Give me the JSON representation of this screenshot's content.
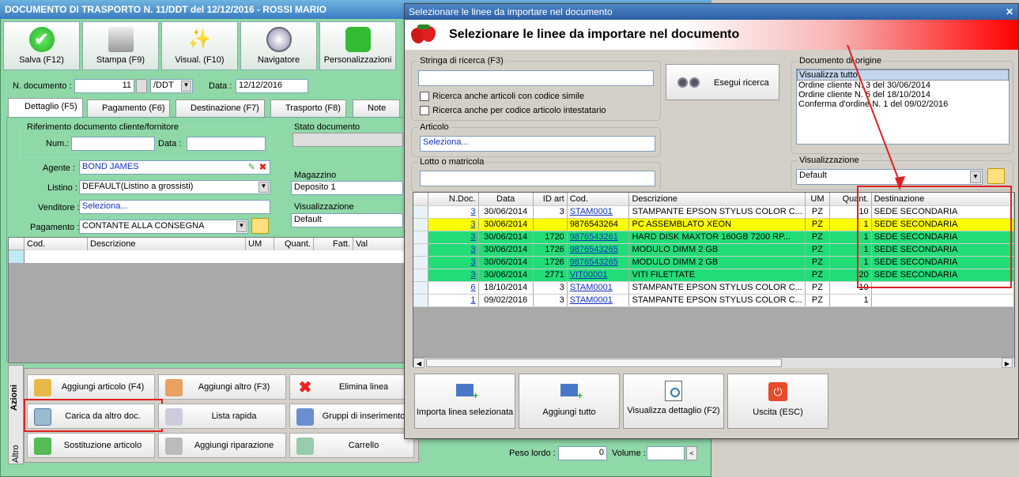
{
  "bg": {
    "title": "DOCUMENTO DI TRASPORTO N. 11/DDT del 12/12/2016 - ROSSI MARIO",
    "toolbar": [
      "Salva (F12)",
      "Stampa (F9)",
      "Visual. (F10)",
      "Navigatore",
      "Personalizzazioni"
    ],
    "ndoc_label": "N. documento :",
    "ndoc_value": "11",
    "ndoc_suffix": "/DDT",
    "data_label": "Data :",
    "data_value": "12/12/2016",
    "tabs": [
      "Dettaglio (F5)",
      "Pagamento (F6)",
      "Destinazione (F7)",
      "Trasporto (F8)",
      "Note"
    ],
    "rif_group": "Riferimento documento cliente/fornitore",
    "num_label": "Num.:",
    "rdata_label": "Data :",
    "stato_label": "Stato documento",
    "agente_label": "Agente :",
    "agente_value": "BOND JAMES",
    "listino_label": "Listino :",
    "listino_value": "DEFAULT(Listino a grossisti)",
    "venditore_label": "Venditore :",
    "venditore_value": "Seleziona...",
    "pagamento_label": "Pagamento :",
    "pagamento_value": "CONTANTE ALLA CONSEGNA",
    "magazzino_label": "Magazzino",
    "magazzino_value": "Deposito 1",
    "vis_label": "Visualizzazione",
    "vis_value": "Default",
    "grid_cols": [
      "Cod.",
      "Descrizione",
      "UM",
      "Quant.",
      "Fatt.",
      "Val"
    ],
    "side_tabs": [
      "Azioni",
      "Altro"
    ],
    "actions": [
      "Aggiungi articolo (F4)",
      "Aggiungi altro (F3)",
      "Elimina linea",
      "Carica da altro doc.",
      "Lista rapida",
      "Gruppi di inserimento",
      "Sostituzione articolo",
      "Aggiungi riparazione",
      "Carrello"
    ],
    "peso_label": "Peso lordo :",
    "peso_value": "0",
    "volume_label": "Volume :"
  },
  "dlg": {
    "title": "Selezionare le linee da importare nel documento",
    "header": "Selezionare le linee da importare nel documento",
    "search_label": "Stringa di ricerca (F3)",
    "chk1": "Ricerca anche articoli con codice simile",
    "chk2": "Ricerca anche per codice articolo intestatario",
    "search_btn": "Esegui ricerca",
    "articolo_label": "Articolo",
    "articolo_value": "Seleziona...",
    "lotto_label": "Lotto o matricola",
    "origine_label": "Documento di origine",
    "origine_items": [
      "Visualizza tutto",
      "Ordine cliente N. 3 del 30/06/2014",
      "Ordine cliente N. 6 del 18/10/2014",
      "Conferma d'ordine N. 1 del 09/02/2016"
    ],
    "vis_label": "Visualizzazione",
    "vis_value": "Default",
    "cols": [
      "N.Doc.",
      "Data",
      "ID art",
      "Cod.",
      "Descrizione",
      "UM",
      "Quant.",
      "Destinazione"
    ],
    "rows": [
      {
        "ndoc": "3",
        "data": "30/06/2014",
        "idart": "3",
        "cod": "STAM0001",
        "desc": "STAMPANTE EPSON STYLUS COLOR C...",
        "um": "PZ",
        "qty": "10",
        "dest": "SEDE SECONDARIA",
        "bg": "#ffffff",
        "link": true
      },
      {
        "ndoc": "3",
        "data": "30/06/2014",
        "idart": "",
        "cod": "9876543264",
        "desc": "PC ASSEMBLATO XEON",
        "um": "PZ",
        "qty": "1",
        "dest": "SEDE SECONDARIA",
        "bg": "#ffff00",
        "link": false
      },
      {
        "ndoc": "3",
        "data": "30/06/2014",
        "idart": "1720",
        "cod": "9876543261",
        "desc": "HARD DISK MAXTOR 160GB 7200 RP...",
        "um": "PZ",
        "qty": "1",
        "dest": "SEDE SECONDARIA",
        "bg": "#22dd77",
        "link": true
      },
      {
        "ndoc": "3",
        "data": "30/06/2014",
        "idart": "1726",
        "cod": "9876543265",
        "desc": "MODULO DIMM 2 GB",
        "um": "PZ",
        "qty": "1",
        "dest": "SEDE SECONDARIA",
        "bg": "#22dd77",
        "link": true
      },
      {
        "ndoc": "3",
        "data": "30/06/2014",
        "idart": "1726",
        "cod": "9876543265",
        "desc": "MODULO DIMM 2 GB",
        "um": "PZ",
        "qty": "1",
        "dest": "SEDE SECONDARIA",
        "bg": "#22dd77",
        "link": true
      },
      {
        "ndoc": "3",
        "data": "30/06/2014",
        "idart": "2771",
        "cod": "VIT00001",
        "desc": "VITI FILETTATE",
        "um": "PZ",
        "qty": "20",
        "dest": "SEDE SECONDARIA",
        "bg": "#22dd77",
        "link": true
      },
      {
        "ndoc": "6",
        "data": "18/10/2014",
        "idart": "3",
        "cod": "STAM0001",
        "desc": "STAMPANTE EPSON STYLUS COLOR C...",
        "um": "PZ",
        "qty": "10",
        "dest": "",
        "bg": "#ffffff",
        "link": true
      },
      {
        "ndoc": "1",
        "data": "09/02/2016",
        "idart": "3",
        "cod": "STAM0001",
        "desc": "STAMPANTE EPSON STYLUS COLOR C...",
        "um": "PZ",
        "qty": "1",
        "dest": "",
        "bg": "#ffffff",
        "link": true
      }
    ],
    "buttons": [
      "Importa linea selezionata",
      "Aggiungi tutto",
      "Visualizza dettaglio (F2)",
      "Uscita (ESC)"
    ]
  }
}
